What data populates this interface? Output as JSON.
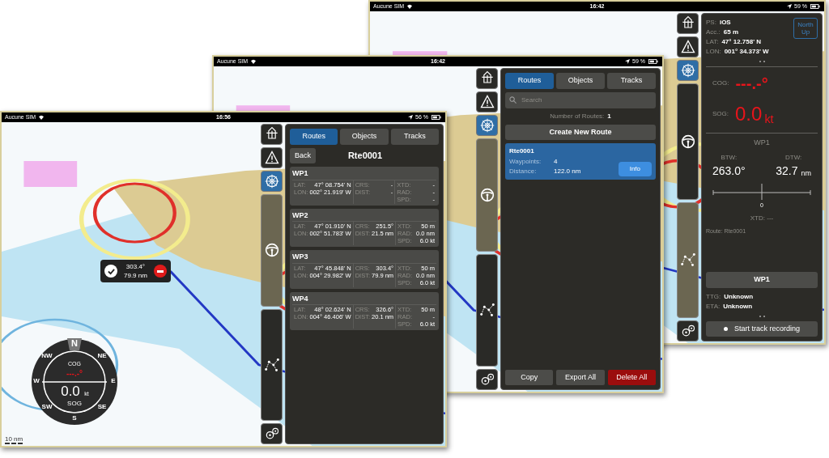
{
  "screens": [
    {
      "kind": "navigation",
      "status_bar": {
        "carrier": "Aucune SIM",
        "time": "16:42",
        "battery": "59 %"
      },
      "panel": {
        "position": [
          {
            "label": "PS:",
            "value": "iOS"
          },
          {
            "label": "Acc.:",
            "value": "65 m"
          },
          {
            "label": "LAT:",
            "value": "47° 12.758' N"
          },
          {
            "label": "LON:",
            "value": "001° 34.373' W"
          }
        ],
        "north_up_button": "North Up",
        "cog": {
          "label": "COG:",
          "value": "---.-°"
        },
        "sog": {
          "label": "SOG:",
          "value": "0.0",
          "unit": "kt"
        },
        "waypoint": "WP1",
        "bearing": {
          "label": "BTW:",
          "value": "263.0°"
        },
        "distance": {
          "label": "DTW:",
          "value": "32.7",
          "unit": "nm"
        },
        "scale_label": "0",
        "xtd": "XTD: ---",
        "route": "Route: Rte0001",
        "waypoint_button": "WP1",
        "times": [
          {
            "label": "TTG:",
            "value": "Unknown"
          },
          {
            "label": "ETA:",
            "value": "Unknown"
          }
        ],
        "record_button": "Start track recording"
      }
    },
    {
      "kind": "route_list",
      "status_bar": {
        "carrier": "Aucune SIM",
        "time": "16:42",
        "battery": "59 %"
      },
      "panel": {
        "tabs": [
          {
            "label": "Routes",
            "selected": true
          },
          {
            "label": "Objects",
            "selected": false
          },
          {
            "label": "Tracks",
            "selected": false
          }
        ],
        "search": {
          "placeholder": "Search"
        },
        "route_count": {
          "label": "Number of Routes:",
          "value": "1"
        },
        "create_button": "Create New Route",
        "routes": [
          {
            "name": "Rte0001",
            "selected": true,
            "details": [
              {
                "label": "Waypoints:",
                "value": "4"
              },
              {
                "label": "Distance:",
                "value": "122.0 nm"
              }
            ],
            "info_button": "Info"
          }
        ],
        "actions": [
          {
            "label": "Copy",
            "kind": "normal"
          },
          {
            "label": "Export All",
            "kind": "normal"
          },
          {
            "label": "Delete All",
            "kind": "danger"
          }
        ]
      }
    },
    {
      "kind": "route_detail",
      "status_bar": {
        "carrier": "Aucune SIM",
        "time": "16:56",
        "battery": "56 %"
      },
      "panel": {
        "tabs": [
          {
            "label": "Routes",
            "selected": true
          },
          {
            "label": "Objects",
            "selected": false
          },
          {
            "label": "Tracks",
            "selected": false
          }
        ],
        "back_button": "Back",
        "title": "Rte0001",
        "waypoints": [
          {
            "name": "WP1",
            "columns": [
              [
                {
                  "label": "LAT:",
                  "value": "47° 08.754' N"
                },
                {
                  "label": "LON:",
                  "value": "002° 21.919' W"
                }
              ],
              [
                {
                  "label": "CRS:",
                  "value": "-"
                },
                {
                  "label": "DIST:",
                  "value": "-"
                }
              ],
              [
                {
                  "label": "XTD:",
                  "value": "-"
                },
                {
                  "label": "RAD:",
                  "value": "-"
                },
                {
                  "label": "SPD:",
                  "value": "-"
                }
              ]
            ]
          },
          {
            "name": "WP2",
            "columns": [
              [
                {
                  "label": "LAT:",
                  "value": "47° 01.910' N"
                },
                {
                  "label": "LON:",
                  "value": "002° 51.783' W"
                }
              ],
              [
                {
                  "label": "CRS:",
                  "value": "251.5°"
                },
                {
                  "label": "DIST:",
                  "value": "21.5 nm"
                }
              ],
              [
                {
                  "label": "XTD:",
                  "value": "50 m"
                },
                {
                  "label": "RAD:",
                  "value": "0.0 nm"
                },
                {
                  "label": "SPD:",
                  "value": "6.0 kt"
                }
              ]
            ]
          },
          {
            "name": "WP3",
            "columns": [
              [
                {
                  "label": "LAT:",
                  "value": "47° 45.848' N"
                },
                {
                  "label": "LON:",
                  "value": "004° 29.982' W"
                }
              ],
              [
                {
                  "label": "CRS:",
                  "value": "303.4°"
                },
                {
                  "label": "DIST:",
                  "value": "79.9 nm"
                }
              ],
              [
                {
                  "label": "XTD:",
                  "value": "50 m"
                },
                {
                  "label": "RAD:",
                  "value": "0.0 nm"
                },
                {
                  "label": "SPD:",
                  "value": "6.0 kt"
                }
              ]
            ]
          },
          {
            "name": "WP4",
            "columns": [
              [
                {
                  "label": "LAT:",
                  "value": "48° 02.624' N"
                },
                {
                  "label": "LON:",
                  "value": "004° 46.406' W"
                }
              ],
              [
                {
                  "label": "CRS:",
                  "value": "326.6°"
                },
                {
                  "label": "DIST:",
                  "value": "20.1 nm"
                }
              ],
              [
                {
                  "label": "XTD:",
                  "value": "50 m"
                },
                {
                  "label": "RAD:",
                  "value": "-"
                },
                {
                  "label": "SPD:",
                  "value": "6.0 kt"
                }
              ]
            ]
          }
        ]
      },
      "popup": {
        "bearing": "303.4°",
        "distance": "79.9 nm"
      },
      "compass": {
        "directions": [
          "N",
          "NE",
          "E",
          "SE",
          "S",
          "SW",
          "W",
          "NW"
        ],
        "cog_label": "COG",
        "cog_value": "---.-°",
        "speed": "0.0",
        "unit": "kt",
        "sog_label": "SOG"
      },
      "scale": "10 nm"
    }
  ]
}
